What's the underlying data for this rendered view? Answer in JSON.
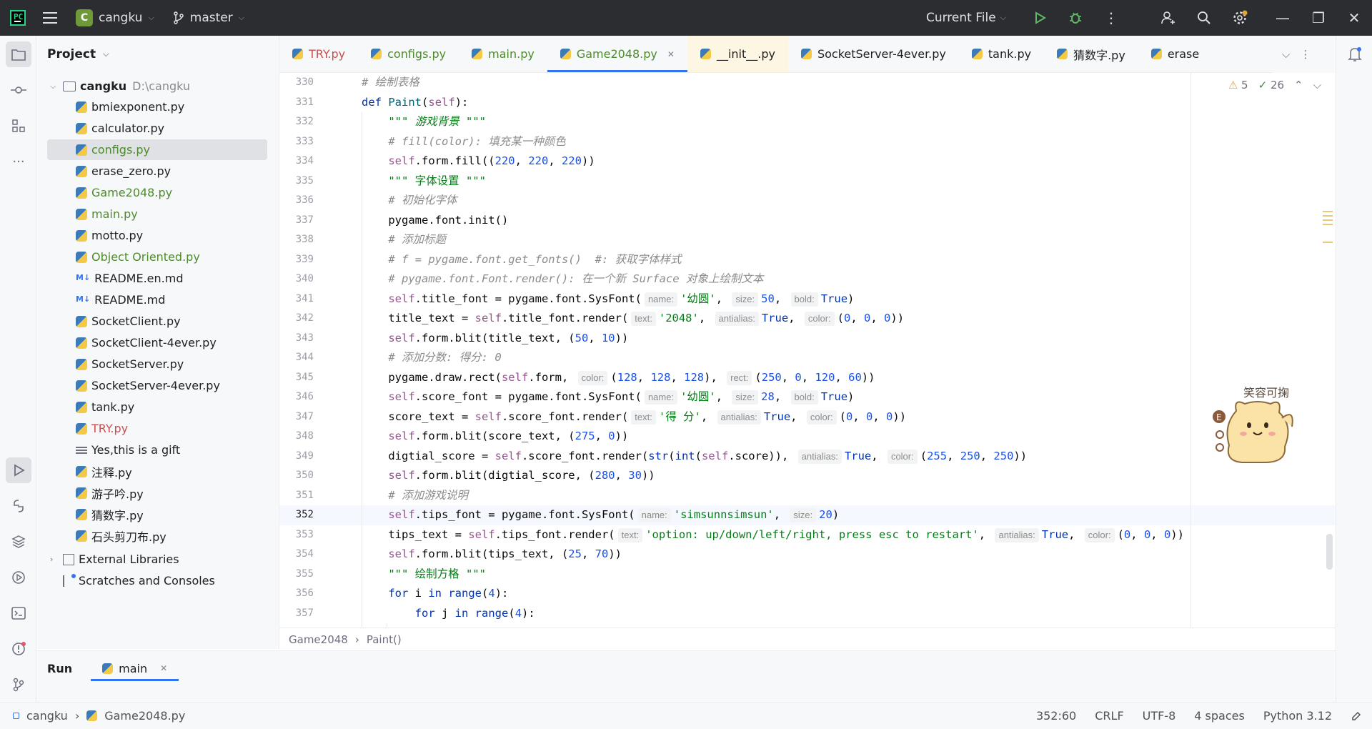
{
  "titlebar": {
    "project_initial": "C",
    "project_name": "cangku",
    "branch": "master",
    "run_config": "Current File"
  },
  "project_panel": {
    "title": "Project",
    "root_name": "cangku",
    "root_path": "D:\\cangku",
    "files": [
      {
        "name": "bmiexponent.py",
        "type": "py",
        "status": "normal"
      },
      {
        "name": "calculator.py",
        "type": "py",
        "status": "normal"
      },
      {
        "name": "configs.py",
        "type": "py",
        "status": "modified",
        "selected": true
      },
      {
        "name": "erase_zero.py",
        "type": "py",
        "status": "normal"
      },
      {
        "name": "Game2048.py",
        "type": "py",
        "status": "modified"
      },
      {
        "name": "main.py",
        "type": "py",
        "status": "modified"
      },
      {
        "name": "motto.py",
        "type": "py",
        "status": "normal"
      },
      {
        "name": "Object Oriented.py",
        "type": "py",
        "status": "modified"
      },
      {
        "name": "README.en.md",
        "type": "md",
        "status": "normal"
      },
      {
        "name": "README.md",
        "type": "md",
        "status": "normal"
      },
      {
        "name": "SocketClient.py",
        "type": "py",
        "status": "normal"
      },
      {
        "name": "SocketClient-4ever.py",
        "type": "py",
        "status": "normal"
      },
      {
        "name": "SocketServer.py",
        "type": "py",
        "status": "normal"
      },
      {
        "name": "SocketServer-4ever.py",
        "type": "py",
        "status": "normal"
      },
      {
        "name": "tank.py",
        "type": "py",
        "status": "normal"
      },
      {
        "name": "TRY.py",
        "type": "py",
        "status": "error"
      },
      {
        "name": "Yes,this is a gift",
        "type": "txt",
        "status": "normal"
      },
      {
        "name": "注释.py",
        "type": "py",
        "status": "normal"
      },
      {
        "name": "游子吟.py",
        "type": "py",
        "status": "normal"
      },
      {
        "name": "猜数字.py",
        "type": "py",
        "status": "normal"
      },
      {
        "name": "石头剪刀布.py",
        "type": "py",
        "status": "normal"
      }
    ],
    "external_libraries": "External Libraries",
    "scratches": "Scratches and Consoles"
  },
  "tabs": [
    {
      "label": "TRY.py",
      "color": "#c94f4f"
    },
    {
      "label": "configs.py",
      "color": "#4e8a2e"
    },
    {
      "label": "main.py",
      "color": "#4e8a2e"
    },
    {
      "label": "Game2048.py",
      "color": "#4e8a2e",
      "active": true
    },
    {
      "label": "__init__.py",
      "color": "#1e1f22",
      "highlight": true
    },
    {
      "label": "SocketServer-4ever.py",
      "color": "#1e1f22"
    },
    {
      "label": "tank.py",
      "color": "#1e1f22"
    },
    {
      "label": "猜数字.py",
      "color": "#1e1f22"
    },
    {
      "label": "erase",
      "color": "#1e1f22"
    }
  ],
  "editor": {
    "warnings": "5",
    "ok_count": "26",
    "current_line": 352,
    "first_line": 330,
    "lines": [
      "<span class='cmt'># 绘制表格</span>",
      "<span class='kw'>def</span> <span class='fn'>Paint</span>(<span class='slf'>self</span>):",
      "    <span class='doc'>\"\"\" 游戏背景 \"\"\"</span>",
      "    <span class='cmt'># fill(color): 填充某一种颜色</span>",
      "    <span class='slf'>self</span>.form.fill((<span class='num'>220</span>, <span class='num'>220</span>, <span class='num'>220</span>))",
      "    <span class='str'>\"\"\" 字体设置 \"\"\"</span>",
      "    <span class='cmt'># 初始化字体</span>",
      "    pygame.font.init()",
      "    <span class='cmt'># 添加标题</span>",
      "    <span class='cmt'># f = pygame.font.get_fonts()  #: 获取字体样式</span>",
      "    <span class='cmt'># pygame.font.Font.render(): 在一个新 Surface 对象上绘制文本</span>",
      "    <span class='slf'>self</span>.title_font = pygame.font.SysFont(<span class='hint'>name:</span><span class='str'>'幼圆'</span>, <span class='hint'>size:</span><span class='num'>50</span>, <span class='hint'>bold:</span><span class='kw'>True</span>)",
      "    title_text = <span class='slf'>self</span>.title_font.render(<span class='hint'>text:</span><span class='str'>'2048'</span>, <span class='hint'>antialias:</span><span class='kw'>True</span>, <span class='hint'>color:</span>(<span class='num'>0</span>, <span class='num'>0</span>, <span class='num'>0</span>))",
      "    <span class='slf'>self</span>.form.blit(title_text, (<span class='num'>50</span>, <span class='num'>10</span>))",
      "    <span class='cmt'># 添加分数: 得分: 0</span>",
      "    pygame.draw.rect(<span class='slf'>self</span>.form, <span class='hint'>color:</span>(<span class='num'>128</span>, <span class='num'>128</span>, <span class='num'>128</span>), <span class='hint'>rect:</span>(<span class='num'>250</span>, <span class='num'>0</span>, <span class='num'>120</span>, <span class='num'>60</span>))",
      "    <span class='slf'>self</span>.score_font = pygame.font.SysFont(<span class='hint'>name:</span><span class='str'>'幼圆'</span>, <span class='hint'>size:</span><span class='num'>28</span>, <span class='hint'>bold:</span><span class='kw'>True</span>)",
      "    score_text = <span class='slf'>self</span>.score_font.render(<span class='hint'>text:</span><span class='str'>'得 分'</span>, <span class='hint'>antialias:</span><span class='kw'>True</span>, <span class='hint'>color:</span>(<span class='num'>0</span>, <span class='num'>0</span>, <span class='num'>0</span>))",
      "    <span class='slf'>self</span>.form.blit(score_text, (<span class='num'>275</span>, <span class='num'>0</span>))",
      "    digtial_score = <span class='slf'>self</span>.score_font.render(<span class='kw'>str</span>(<span class='kw'>int</span>(<span class='slf'>self</span>.score)), <span class='hint'>antialias:</span><span class='kw'>True</span>, <span class='hint'>color:</span>(<span class='num'>255</span>, <span class='num'>250</span>, <span class='num'>250</span>))",
      "    <span class='slf'>self</span>.form.blit(digtial_score, (<span class='num'>280</span>, <span class='num'>30</span>))",
      "    <span class='cmt'># 添加游戏说明</span>",
      "    <span class='slf'>self</span>.tips_font = pygame.font.SysFont(<span class='hint'>name:</span><span class='str'>'simsunnsimsun'</span>, <span class='hint'>size:</span><span class='num'>20</span>)",
      "    tips_text = <span class='slf'>self</span>.tips_font.render(<span class='hint'>text:</span><span class='str'>'option: up/down/left/right, press esc to restart'</span>, <span class='hint'>antialias:</span><span class='kw'>True</span>, <span class='hint'>color:</span>(<span class='num'>0</span>, <span class='num'>0</span>, <span class='num'>0</span>))",
      "    <span class='slf'>self</span>.form.blit(tips_text, (<span class='num'>25</span>, <span class='num'>70</span>))",
      "    <span class='str'>\"\"\" 绘制方格 \"\"\"</span>",
      "    <span class='kw'>for</span> i <span class='kw'>in</span> <span class='kw'>range</span>(<span class='num'>4</span>):",
      "        <span class='kw'>for</span> j <span class='kw'>in</span> <span class='kw'>range</span>(<span class='num'>4</span>):"
    ]
  },
  "breadcrumb": {
    "file": "Game2048",
    "func": "Paint()"
  },
  "run_panel": {
    "title": "Run",
    "tab": "main"
  },
  "statusbar": {
    "project": "cangku",
    "file": "Game2048.py",
    "position": "352:60",
    "line_sep": "CRLF",
    "encoding": "UTF-8",
    "indent": "4 spaces",
    "interpreter": "Python 3.12"
  },
  "sticker_text": "笑容可掬"
}
